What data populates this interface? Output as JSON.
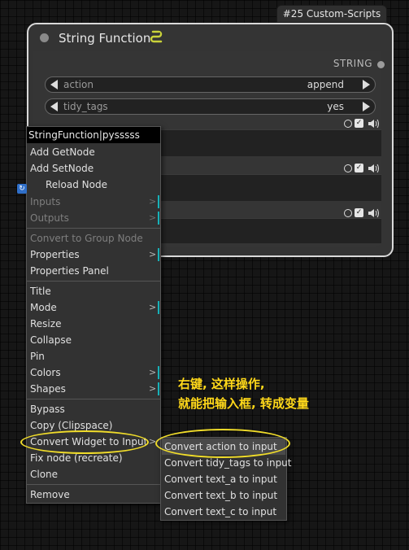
{
  "badge": "#25 Custom-Scripts",
  "node": {
    "title": "String Function",
    "output_label": "STRING",
    "widgets": [
      {
        "name": "action",
        "value": "append"
      },
      {
        "name": "tidy_tags",
        "value": "yes"
      }
    ]
  },
  "menu": {
    "header": "StringFunction|pysssss",
    "items": {
      "add_getnode": "Add GetNode",
      "add_setnode": "Add SetNode",
      "reload_node": "Reload Node",
      "inputs": "Inputs",
      "outputs": "Outputs",
      "convert_group": "Convert to Group Node",
      "properties": "Properties",
      "properties_panel": "Properties Panel",
      "title": "Title",
      "mode": "Mode",
      "resize": "Resize",
      "collapse": "Collapse",
      "pin": "Pin",
      "colors": "Colors",
      "shapes": "Shapes",
      "bypass": "Bypass",
      "copy_clipspace": "Copy (Clipspace)",
      "convert_widget": "Convert Widget to Input",
      "fix_node": "Fix node (recreate)",
      "clone": "Clone",
      "remove": "Remove"
    }
  },
  "submenu": {
    "items": [
      "Convert action to input",
      "Convert tidy_tags to input",
      "Convert text_a to input",
      "Convert text_b to input",
      "Convert text_c to input"
    ]
  },
  "annotation": {
    "line1": "右键, 这样操作,",
    "line2": "就能把输入框, 转成变量"
  },
  "colors": {
    "accent_highlight": "#f0dc2a",
    "annotation_text": "#ffd81a",
    "submenu_indicator": "#17b1b8",
    "node_border": "#d9d9d9"
  },
  "icons": [
    "snake-icon",
    "reload-icon",
    "speaker-icon",
    "checkbox-icon",
    "circle-toggle-icon",
    "arrow-left-icon",
    "arrow-right-icon"
  ]
}
